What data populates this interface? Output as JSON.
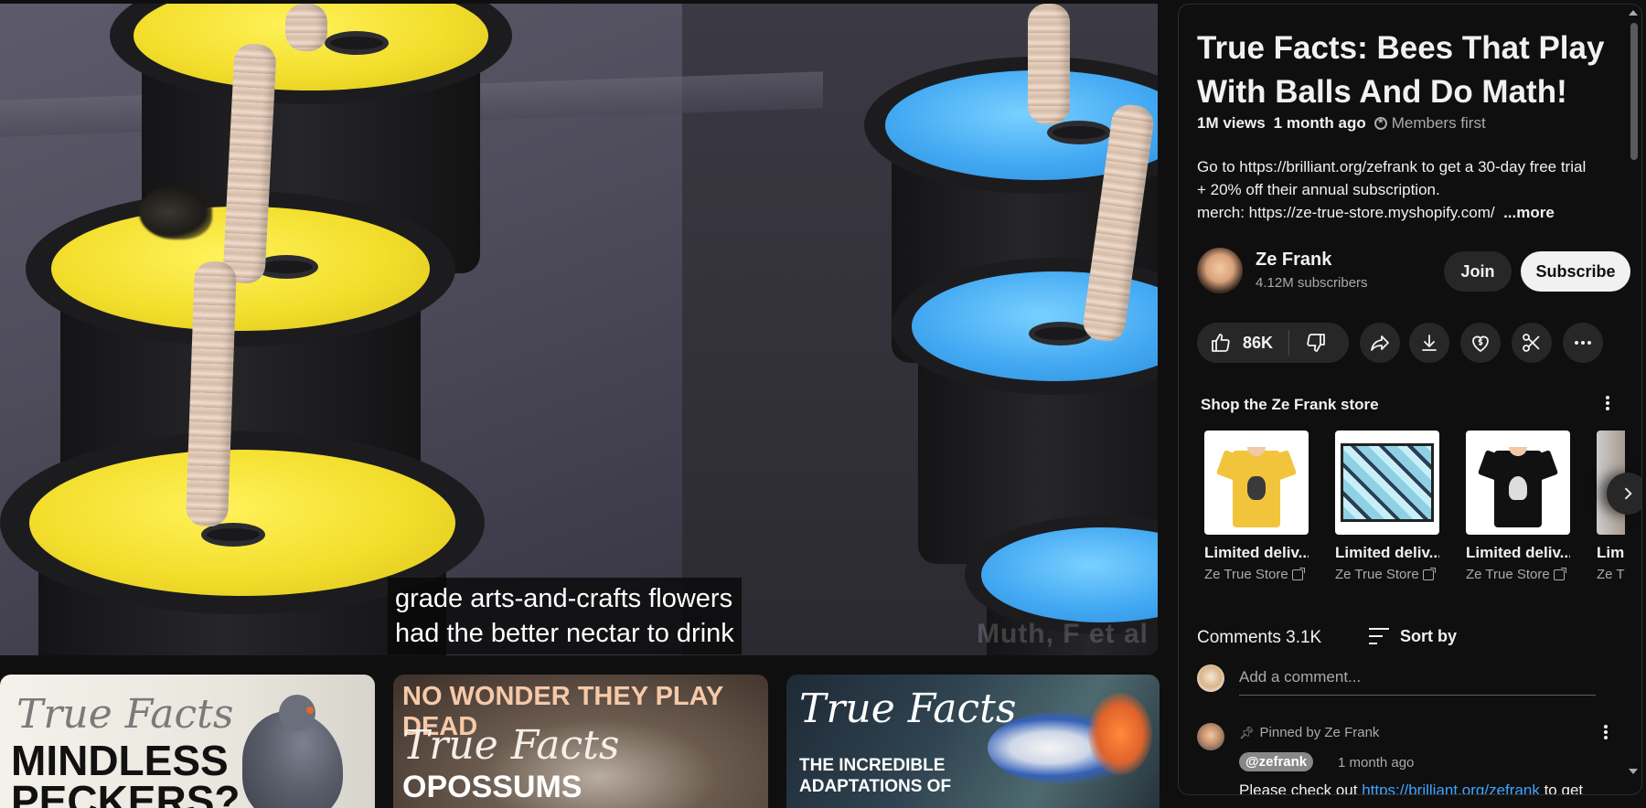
{
  "video": {
    "caption_lines": [
      "grade arts-and-crafts flowers",
      "had the better nectar to drink"
    ],
    "watermark": "Muth, F et al"
  },
  "recommended": [
    {
      "script": "True Facts",
      "headline": "MINDLESS PECKERS?"
    },
    {
      "top_text": "NO WONDER THEY PLAY DEAD",
      "script": "True Facts",
      "headline": "OPOSSUMS"
    },
    {
      "script": "True Facts",
      "headline_lines": [
        "THE INCREDIBLE",
        "ADAPTATIONS OF"
      ]
    }
  ],
  "panel": {
    "title": "True Facts: Bees That Play With Balls And Do Math!",
    "views": "1M views",
    "age": "1 month ago",
    "members_label": "Members first",
    "description_lines": [
      "Go to https://brilliant.org/zefrank to get a 30-day free trial",
      "+ 20% off their annual subscription.",
      "merch: https://ze-true-store.myshopify.com/"
    ],
    "more_label": "...more",
    "channel": {
      "name": "Ze Frank",
      "subscribers": "4.12M subscribers",
      "join_label": "Join",
      "subscribe_label": "Subscribe"
    },
    "actions": {
      "like_count": "86K"
    },
    "shop": {
      "title": "Shop the Ze Frank store",
      "products": [
        {
          "name": "Limited deliv...",
          "store": "Ze True Store"
        },
        {
          "name": "Limited deliv...",
          "store": "Ze True Store"
        },
        {
          "name": "Limited deliv...",
          "store": "Ze True Store"
        },
        {
          "name": "Limi",
          "store": "Ze T"
        }
      ]
    },
    "comments": {
      "header": "Comments 3.1K",
      "sort_label": "Sort by",
      "add_placeholder": "Add a comment...",
      "pinned": {
        "pinned_by": "Pinned by Ze Frank",
        "handle": "@zefrank",
        "time": "1 month ago",
        "text_prefix": "Please check out ",
        "link": "https://brilliant.org/zefrank",
        "text_suffix": " to get"
      }
    }
  },
  "colors": {
    "background": "#0f0f0f",
    "button": "#272727",
    "link": "#3ea6ff",
    "muted": "#aaaaaa"
  }
}
